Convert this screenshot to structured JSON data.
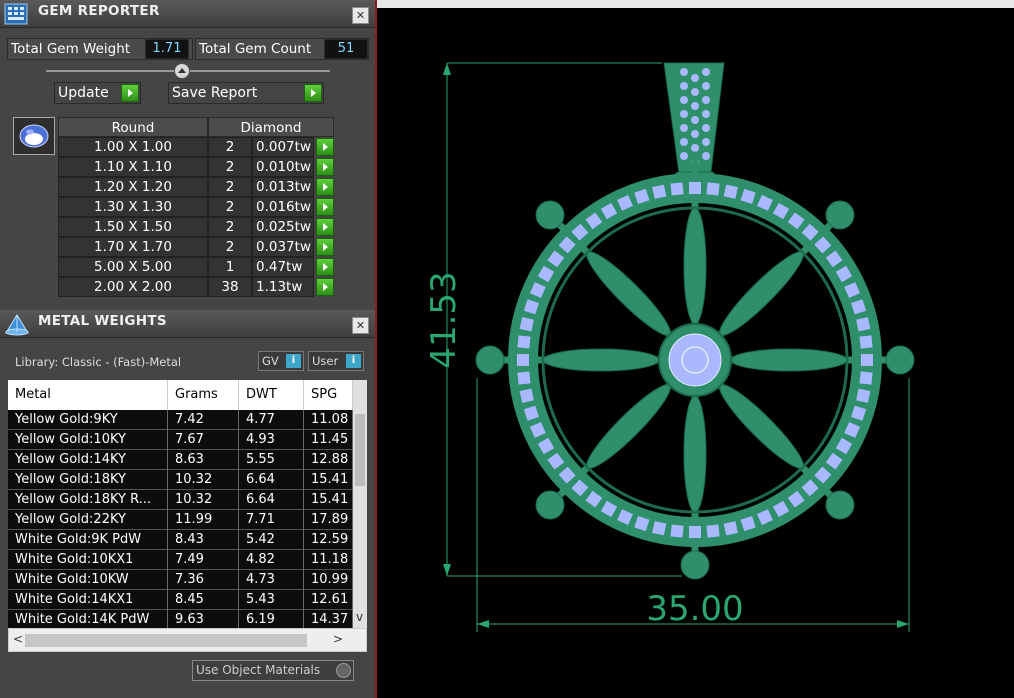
{
  "gem_reporter": {
    "title": "GEM REPORTER",
    "close_glyph": "✕",
    "total_weight_label": "Total Gem Weight",
    "total_weight_value": "1.71",
    "total_count_label": "Total Gem Count",
    "total_count_value": "51",
    "update_label": "Update",
    "save_label": "Save Report",
    "shape_header": "Round",
    "stone_header": "Diamond",
    "rows": [
      {
        "size": "1.00 X 1.00",
        "count": "2",
        "weight": "0.007tw"
      },
      {
        "size": "1.10 X 1.10",
        "count": "2",
        "weight": "0.010tw"
      },
      {
        "size": "1.20 X 1.20",
        "count": "2",
        "weight": "0.013tw"
      },
      {
        "size": "1.30 X 1.30",
        "count": "2",
        "weight": "0.016tw"
      },
      {
        "size": "1.50 X 1.50",
        "count": "2",
        "weight": "0.025tw"
      },
      {
        "size": "1.70 X 1.70",
        "count": "2",
        "weight": "0.037tw"
      },
      {
        "size": "5.00 X 5.00",
        "count": "1",
        "weight": "0.47tw"
      },
      {
        "size": "2.00 X 2.00",
        "count": "38",
        "weight": "1.13tw"
      }
    ],
    "slider_position": 0.48
  },
  "metal_weights": {
    "title": "METAL WEIGHTS",
    "close_glyph": "✕",
    "library": "Library: Classic - (Fast)-Metal",
    "gv_label": "GV",
    "user_label": "User",
    "info_glyph": "i",
    "columns": [
      "Metal",
      "Grams",
      "DWT",
      "SPG"
    ],
    "rows": [
      {
        "metal": "Yellow Gold:9KY",
        "grams": "7.42",
        "dwt": "4.77",
        "spg": "11.08"
      },
      {
        "metal": "Yellow Gold:10KY",
        "grams": "7.67",
        "dwt": "4.93",
        "spg": "11.45"
      },
      {
        "metal": "Yellow Gold:14KY",
        "grams": "8.63",
        "dwt": "5.55",
        "spg": "12.88"
      },
      {
        "metal": "Yellow Gold:18KY",
        "grams": "10.32",
        "dwt": "6.64",
        "spg": "15.41"
      },
      {
        "metal": "Yellow Gold:18KY R...",
        "grams": "10.32",
        "dwt": "6.64",
        "spg": "15.41"
      },
      {
        "metal": "Yellow Gold:22KY",
        "grams": "11.99",
        "dwt": "7.71",
        "spg": "17.89"
      },
      {
        "metal": "White Gold:9K PdW",
        "grams": "8.43",
        "dwt": "5.42",
        "spg": "12.59"
      },
      {
        "metal": "White Gold:10KX1",
        "grams": "7.49",
        "dwt": "4.82",
        "spg": "11.18"
      },
      {
        "metal": "White Gold:10KW",
        "grams": "7.36",
        "dwt": "4.73",
        "spg": "10.99"
      },
      {
        "metal": "White Gold:14KX1",
        "grams": "8.45",
        "dwt": "5.43",
        "spg": "12.61"
      },
      {
        "metal": "White Gold:14K PdW",
        "grams": "9.63",
        "dwt": "6.19",
        "spg": "14.37"
      }
    ],
    "scroll_left": "<",
    "scroll_right": ">",
    "scroll_down": "v",
    "use_materials_label": "Use Object Materials"
  },
  "viewport": {
    "height_dimension": "41.53",
    "width_dimension": "35.00",
    "metal_color": "#2e8f6a",
    "gem_color": "#a9b8ff",
    "dimension_color": "#2aa66f"
  }
}
